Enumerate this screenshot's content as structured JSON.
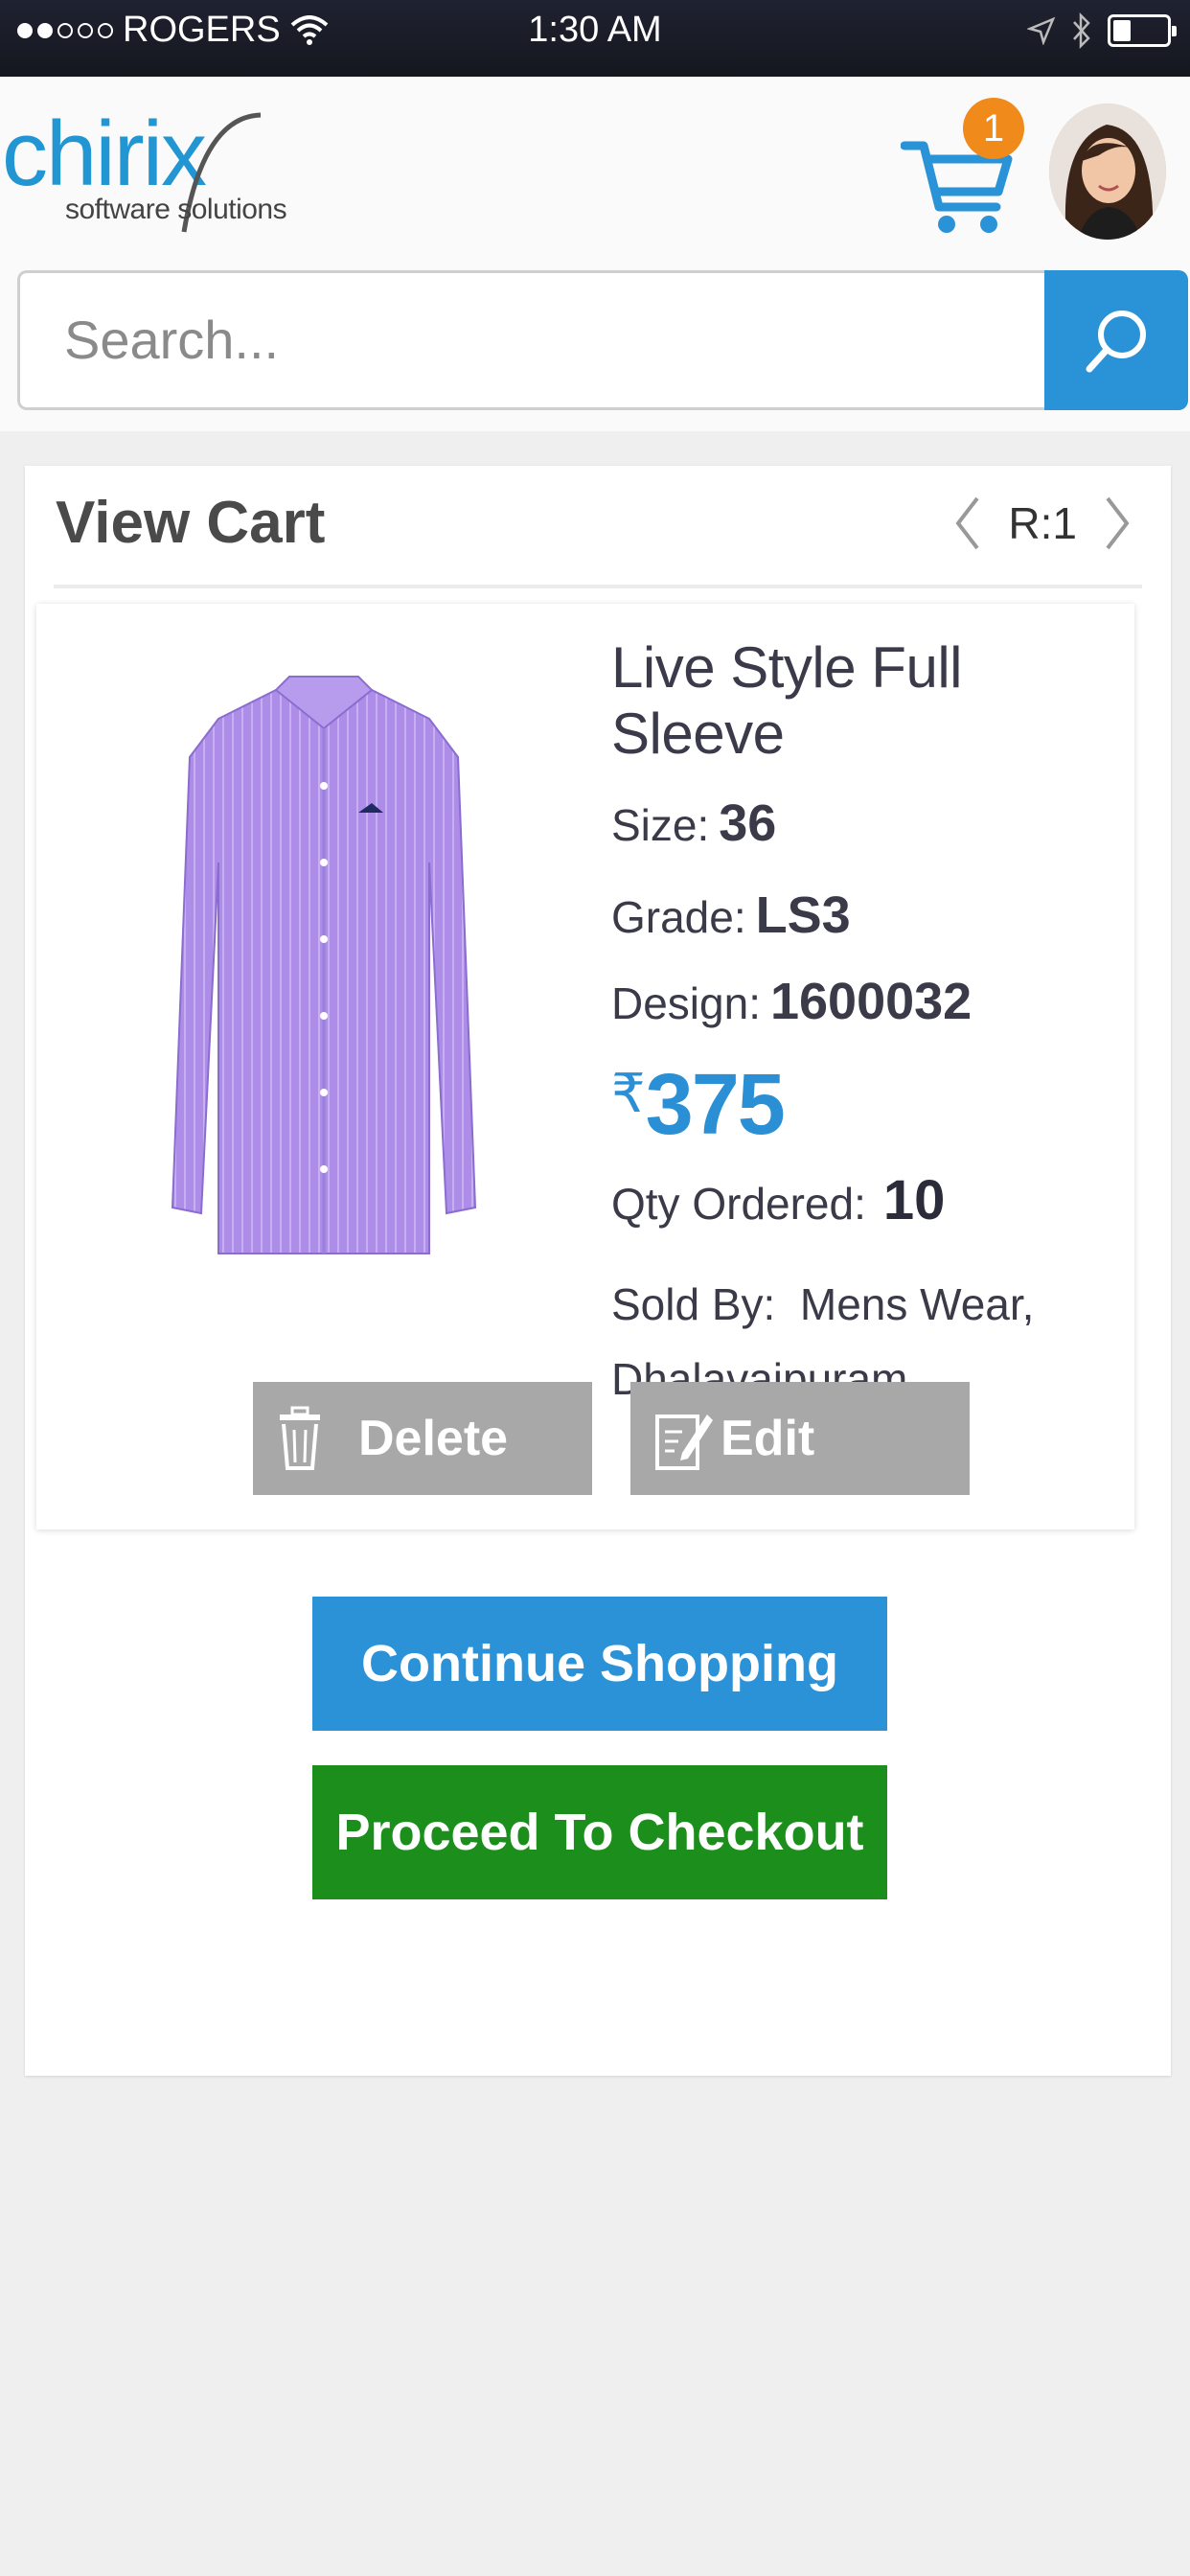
{
  "status_bar": {
    "carrier": "ROGERS",
    "time": "1:30 AM",
    "signal_bars": 2,
    "signal_total": 5
  },
  "header": {
    "logo_text": "chirix",
    "logo_tagline": "software solutions",
    "cart_count": "1",
    "search_placeholder": "Search..."
  },
  "view_cart": {
    "title": "View Cart",
    "pager_label": "R:1"
  },
  "item": {
    "name": "Live Style Full Sleeve",
    "size_label": "Size:",
    "size_value": "36",
    "grade_label": "Grade:",
    "grade_value": "LS3",
    "design_label": "Design:",
    "design_value": "1600032",
    "currency_symbol": "₹",
    "price": "375",
    "qty_label": "Qty Ordered:",
    "qty_value": "10",
    "sold_by_label": "Sold By:",
    "sold_by_value_line1": "Mens Wear,",
    "sold_by_value_line2": "Dhalavaipuram",
    "delete_label": "Delete",
    "edit_label": "Edit"
  },
  "actions": {
    "continue_label": "Continue Shopping",
    "checkout_label": "Proceed To Checkout"
  },
  "colors": {
    "brand_blue": "#2196d3",
    "checkout_green": "#1c8e1c",
    "badge_orange": "#ef8a1b",
    "button_gray": "#a8a8a8"
  }
}
